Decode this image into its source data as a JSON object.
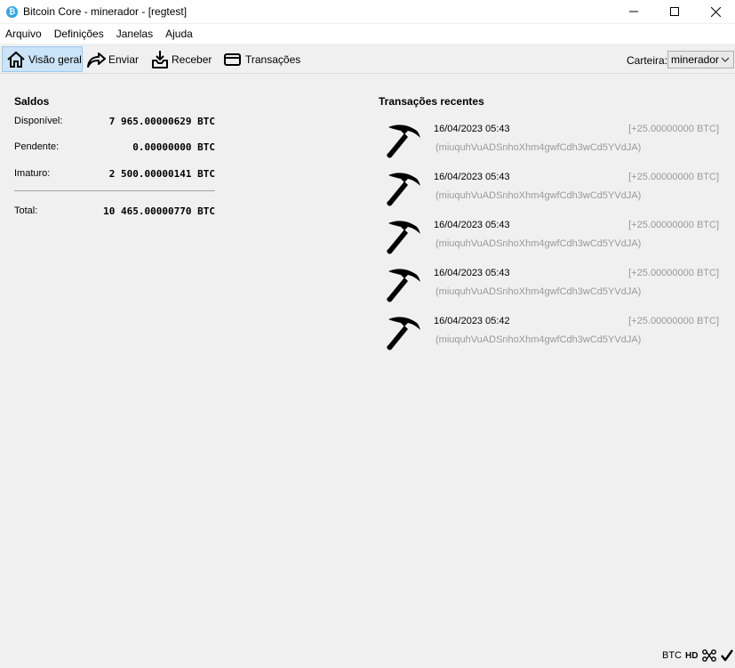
{
  "window": {
    "title": "Bitcoin Core - minerador - [regtest]",
    "app_icon_glyph": "₿"
  },
  "menu": [
    "Arquivo",
    "Definições",
    "Janelas",
    "Ajuda"
  ],
  "toolbar": {
    "overview": "Visão geral",
    "send": "Enviar",
    "receive": "Receber",
    "transactions": "Transações",
    "wallet_label": "Carteira:",
    "wallet_value": "minerador"
  },
  "balances": {
    "title": "Saldos",
    "available_label": "Disponível:",
    "available_value": "7 965.00000629 BTC",
    "pending_label": "Pendente:",
    "pending_value": "0.00000000 BTC",
    "immature_label": "Imaturo:",
    "immature_value": "2 500.00000141 BTC",
    "total_label": "Total:",
    "total_value": "10 465.00000770 BTC"
  },
  "recent": {
    "title": "Transações recentes",
    "icon": "pickaxe-icon",
    "items": [
      {
        "date": "16/04/2023 05:43",
        "amount": "[+25.00000000 BTC]",
        "address": "(miuquhVuADSnhoXhm4gwfCdh3wCd5YVdJA)"
      },
      {
        "date": "16/04/2023 05:43",
        "amount": "[+25.00000000 BTC]",
        "address": "(miuquhVuADSnhoXhm4gwfCdh3wCd5YVdJA)"
      },
      {
        "date": "16/04/2023 05:43",
        "amount": "[+25.00000000 BTC]",
        "address": "(miuquhVuADSnhoXhm4gwfCdh3wCd5YVdJA)"
      },
      {
        "date": "16/04/2023 05:43",
        "amount": "[+25.00000000 BTC]",
        "address": "(miuquhVuADSnhoXhm4gwfCdh3wCd5YVdJA)"
      },
      {
        "date": "16/04/2023 05:42",
        "amount": "[+25.00000000 BTC]",
        "address": "(miuquhVuADSnhoXhm4gwfCdh3wCd5YVdJA)"
      }
    ]
  },
  "status": {
    "unit": "BTC",
    "hd": "HD"
  },
  "colors": {
    "accent_selected": "#cce4f7",
    "app_icon": "#2fa7e6",
    "muted_text": "#999999"
  }
}
